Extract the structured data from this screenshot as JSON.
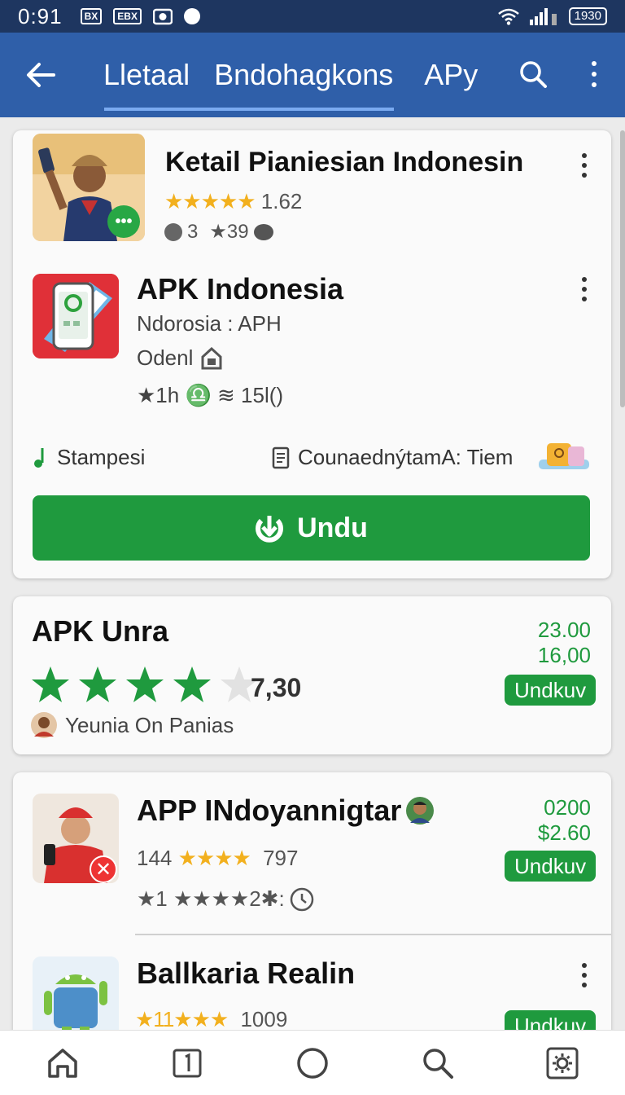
{
  "status_bar": {
    "time": "0:91",
    "icon_a": "BX",
    "icon_b": "EBX",
    "battery": "1930"
  },
  "app_bar": {
    "tabs": [
      {
        "label": "Lletaal"
      },
      {
        "label": "Bndohagkons"
      },
      {
        "label": "APy"
      }
    ]
  },
  "featured": {
    "title": "Ketail Pianiesian Indonesin",
    "stars": "★★★★★",
    "rating": "1.62",
    "stat_a": "3",
    "stat_b": "★39"
  },
  "apk_indonesia": {
    "title": "APK Indonesia",
    "subtitle": "Ndorosia : APH",
    "label": "Odenl",
    "meta": "★1h ♎ ≋ 15l()"
  },
  "info_row": {
    "left": "Stampesi",
    "right": "CounaednýtamA: Tiem"
  },
  "download_button": {
    "label": "Undu"
  },
  "apk_unra": {
    "title": "APK Unra",
    "rating": "7,30",
    "author": "Yeunia On Panias",
    "price_top": "23.00",
    "price_bottom": "16,00",
    "button": "Undkuv"
  },
  "app_indoy": {
    "title": "APP INdoyannigtar",
    "count": "144",
    "stars": "★★★★",
    "rating": "797",
    "meta": "★1 ★★★★2✱:",
    "price_top": "0200",
    "price_bottom": "$2.60",
    "button": "Undkuv"
  },
  "ballkaria": {
    "title": "Ballkaria Realin",
    "stars": "★11★★★",
    "rating": "1009",
    "button": "Undkuv"
  },
  "colors": {
    "app_bar": "#2f5fa9",
    "status_bar": "#1e3660",
    "accent_green": "#1f9a3e",
    "star": "#f2b01e"
  }
}
